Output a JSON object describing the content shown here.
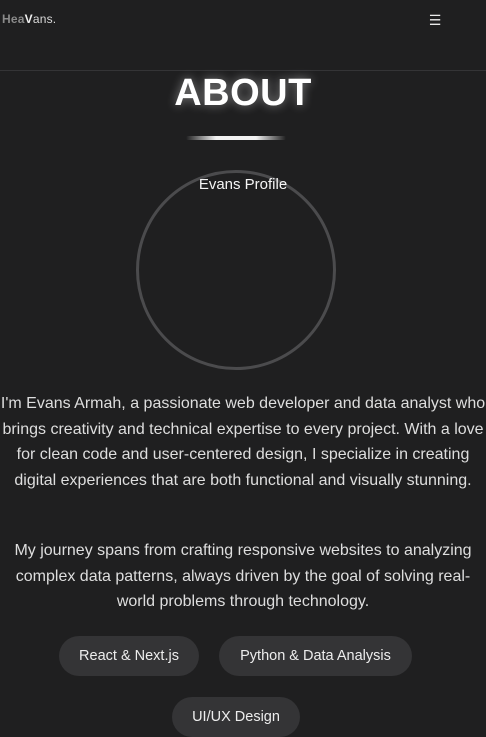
{
  "header": {
    "logo_mark": "Hea",
    "logo_v": "V",
    "logo_rest": "ans.",
    "menu_icon": "hamburger-menu-icon",
    "menu_glyph": "☰"
  },
  "about": {
    "title": "ABOUT",
    "profile_alt": "Evans Profile",
    "paragraph1": "I'm Evans Armah, a passionate web developer and data analyst who brings creativity and technical expertise to every project. With a love for clean code and user-centered design, I specialize in creating digital experiences that are both functional and visually stunning.",
    "paragraph2": "My journey spans from crafting responsive websites to analyzing complex data patterns, always driven by the goal of solving real-world problems through technology.",
    "skills": [
      "React & Next.js",
      "Python & Data Analysis",
      "UI/UX Design"
    ]
  },
  "colors": {
    "background": "#1f1f20",
    "chip": "#343436",
    "text": "#dedede"
  }
}
